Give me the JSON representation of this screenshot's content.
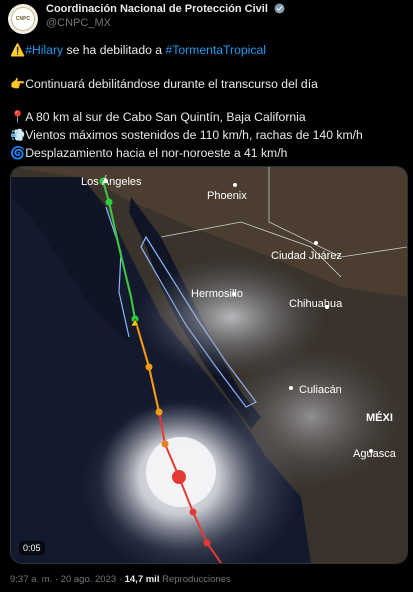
{
  "account": {
    "name": "Coordinación Nacional de Protección Civil",
    "handle": "@CNPC_MX",
    "avatar_text": "CNPC"
  },
  "tweet": {
    "line1_emoji": "⚠️",
    "line1_tag1": "#Hilary",
    "line1_mid": " se ha debilitado a ",
    "line1_tag2": "#TormentaTropical",
    "line2_emoji": "👉",
    "line2_text": "Continuará debilitándose durante el transcurso del día",
    "line3_emoji": "📍",
    "line3_text": "A 80 km al sur de Cabo San Quintín, Baja California",
    "line4_emoji": "💨",
    "line4_text": "Vientos máximos sostenidos de 110 km/h, rachas de 140 km/h",
    "line5_emoji": "🌀",
    "line5_text": "Desplazamiento hacia el nor-noroeste a 41 km/h"
  },
  "map": {
    "labels": {
      "los_angeles": "Los Ángeles",
      "phoenix": "Phoenix",
      "ciudad_juarez": "Ciudad Juárez",
      "hermosillo": "Hermosillo",
      "chihuahua": "Chihuahua",
      "culiacan": "Culiacán",
      "mexico": "MÉXI",
      "aguascalientes": "Aguasca"
    },
    "video_time": "0:05"
  },
  "footer": {
    "time": "9:37 a. m. · 20 ago. 2023 · ",
    "views": "14,7 mil",
    "views_label": " Reproducciones"
  }
}
